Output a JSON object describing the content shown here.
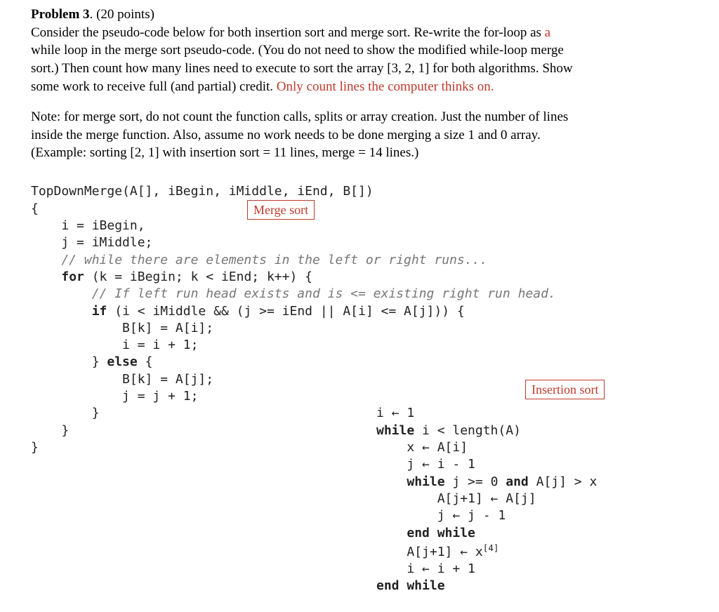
{
  "heading": {
    "title_bold": "Problem 3",
    "title_rest": ". (20 points)"
  },
  "para1": {
    "l1a": "Consider the pseudo-code below for both insertion sort and merge sort.  Re-write the for-loop as ",
    "l1b": "a",
    "l2": "while loop in the merge sort pseudo-code.  (You do not need to show the modified while-loop merge",
    "l3": "sort.)   Then count how many lines need to execute to sort the array [3, 2, 1] for both algorithms.  Show",
    "l4": "some work to receive full (and partial) credit.  ",
    "l4red": "Only count lines the computer thinks on."
  },
  "para2": {
    "l1": "Note: for merge sort, do not count the function calls, splits or array creation.  Just the number of lines",
    "l2a": "inside",
    "l2b": " the merge function.  Also, assume no work needs to be done merging a size 1 and 0 array.",
    "l3": "(Example: sorting [2, 1] with insertion sort = 11 lines, merge = 14 lines.)"
  },
  "labels": {
    "merge": "Merge sort",
    "insertion": "Insertion sort"
  },
  "merge_code": {
    "l1": "TopDownMerge(A[], iBegin, iMiddle, iEnd, B[])",
    "l2": "{",
    "l3": "    i = iBegin,",
    "l4": "    j = iMiddle;",
    "l5c": "    // while there are elements in the left or right runs...",
    "l6a": "    ",
    "l6for": "for",
    "l6b": " (k = iBegin; k < iEnd; k++) {",
    "l7c": "        // If left run head exists and is <= existing right run head.",
    "l8a": "        ",
    "l8if": "if",
    "l8b": " (i < iMiddle && (j >= iEnd || A[i] <= A[j])) {",
    "l9": "            B[k] = A[i];",
    "l10": "            i = i + 1;",
    "l11a": "        } ",
    "l11else": "else",
    "l11b": " {",
    "l12": "            B[k] = A[j];",
    "l13": "            j = j + 1;",
    "l14": "        }",
    "l15": "    }",
    "l16": "}"
  },
  "insertion_code": {
    "l1": "i ← 1",
    "l2a": "while",
    "l2b": " i < length(A)",
    "l3": "    x ← A[i]",
    "l4": "    j ← i - 1",
    "l5a": "    ",
    "l5while": "while",
    "l5b": " j >= 0 ",
    "l5and": "and",
    "l5c": " A[j] > x",
    "l6": "        A[j+1] ← A[j]",
    "l7": "        j ← j - 1",
    "l8a": "    ",
    "l8end": "end while",
    "l9a": "    A[j+1] ← x",
    "l9sup": "[4]",
    "l10": "    i ← i + 1",
    "l11": "end while"
  }
}
